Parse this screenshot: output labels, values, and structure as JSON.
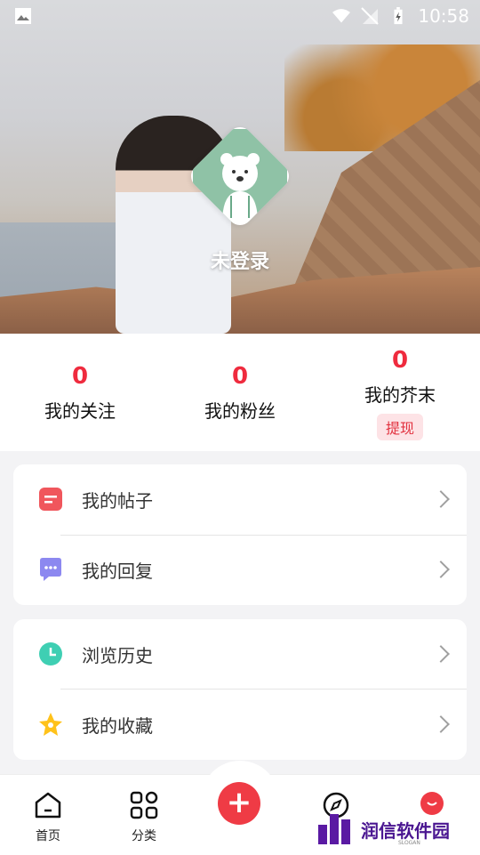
{
  "status_bar": {
    "time": "10:58"
  },
  "profile": {
    "login_text": "未登录"
  },
  "stats": [
    {
      "value": "0",
      "label": "我的关注"
    },
    {
      "value": "0",
      "label": "我的粉丝"
    },
    {
      "value": "0",
      "label": "我的芥末",
      "action": "提现"
    }
  ],
  "menu_card_1": [
    {
      "label": "我的帖子",
      "icon": "post-icon"
    },
    {
      "label": "我的回复",
      "icon": "reply-icon"
    }
  ],
  "menu_card_2": [
    {
      "label": "浏览历史",
      "icon": "clock-icon"
    },
    {
      "label": "我的收藏",
      "icon": "star-icon"
    }
  ],
  "bottom_nav": {
    "home": "首页",
    "category": "分类"
  },
  "watermark": {
    "text": "润信软件园",
    "slogan": "SLOGAN"
  },
  "colors": {
    "accent": "#ef2b3e",
    "withdraw_bg": "#fde3e6"
  }
}
